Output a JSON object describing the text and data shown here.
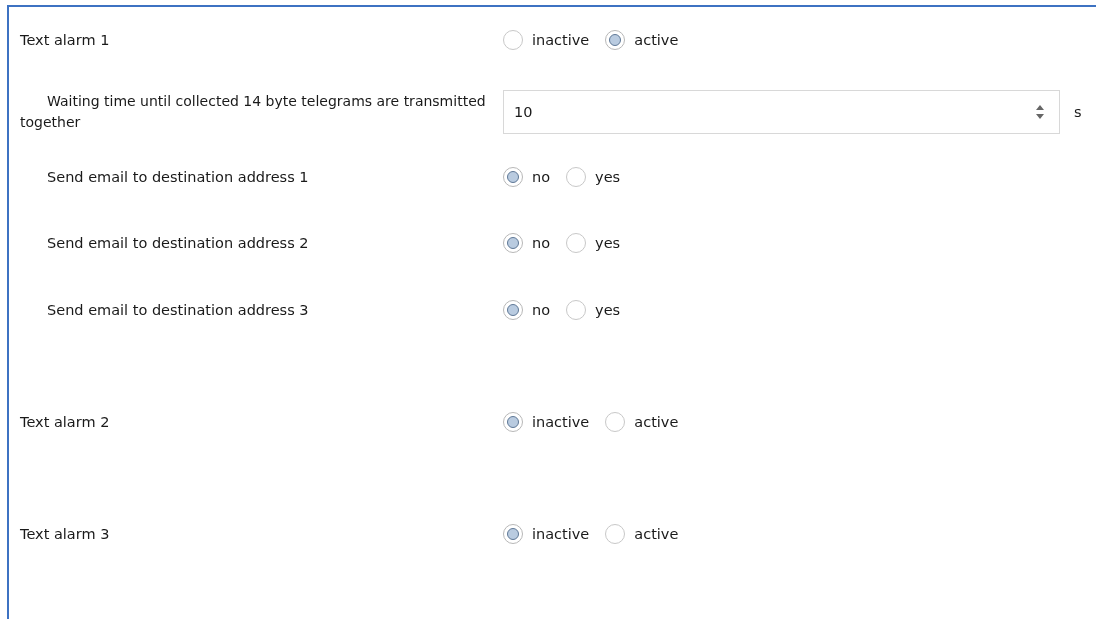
{
  "alarms": [
    {
      "label": "Text alarm 1",
      "kind": "radio",
      "options": [
        {
          "label": "inactive",
          "selected": false
        },
        {
          "label": "active",
          "selected": true
        }
      ],
      "children": [
        {
          "label": "Waiting time until collected 14 byte telegrams are transmitted together",
          "kind": "spinner",
          "value": "10",
          "unit": "s"
        },
        {
          "label": "Send email to destination address 1",
          "kind": "radio",
          "options": [
            {
              "label": "no",
              "selected": true
            },
            {
              "label": "yes",
              "selected": false
            }
          ]
        },
        {
          "label": "Send email to destination address 2",
          "kind": "radio",
          "options": [
            {
              "label": "no",
              "selected": true
            },
            {
              "label": "yes",
              "selected": false
            }
          ]
        },
        {
          "label": "Send email to destination address 3",
          "kind": "radio",
          "options": [
            {
              "label": "no",
              "selected": true
            },
            {
              "label": "yes",
              "selected": false
            }
          ]
        }
      ]
    },
    {
      "label": "Text alarm 2",
      "kind": "radio",
      "options": [
        {
          "label": "inactive",
          "selected": true
        },
        {
          "label": "active",
          "selected": false
        }
      ]
    },
    {
      "label": "Text alarm 3",
      "kind": "radio",
      "options": [
        {
          "label": "inactive",
          "selected": true
        },
        {
          "label": "active",
          "selected": false
        }
      ]
    }
  ]
}
